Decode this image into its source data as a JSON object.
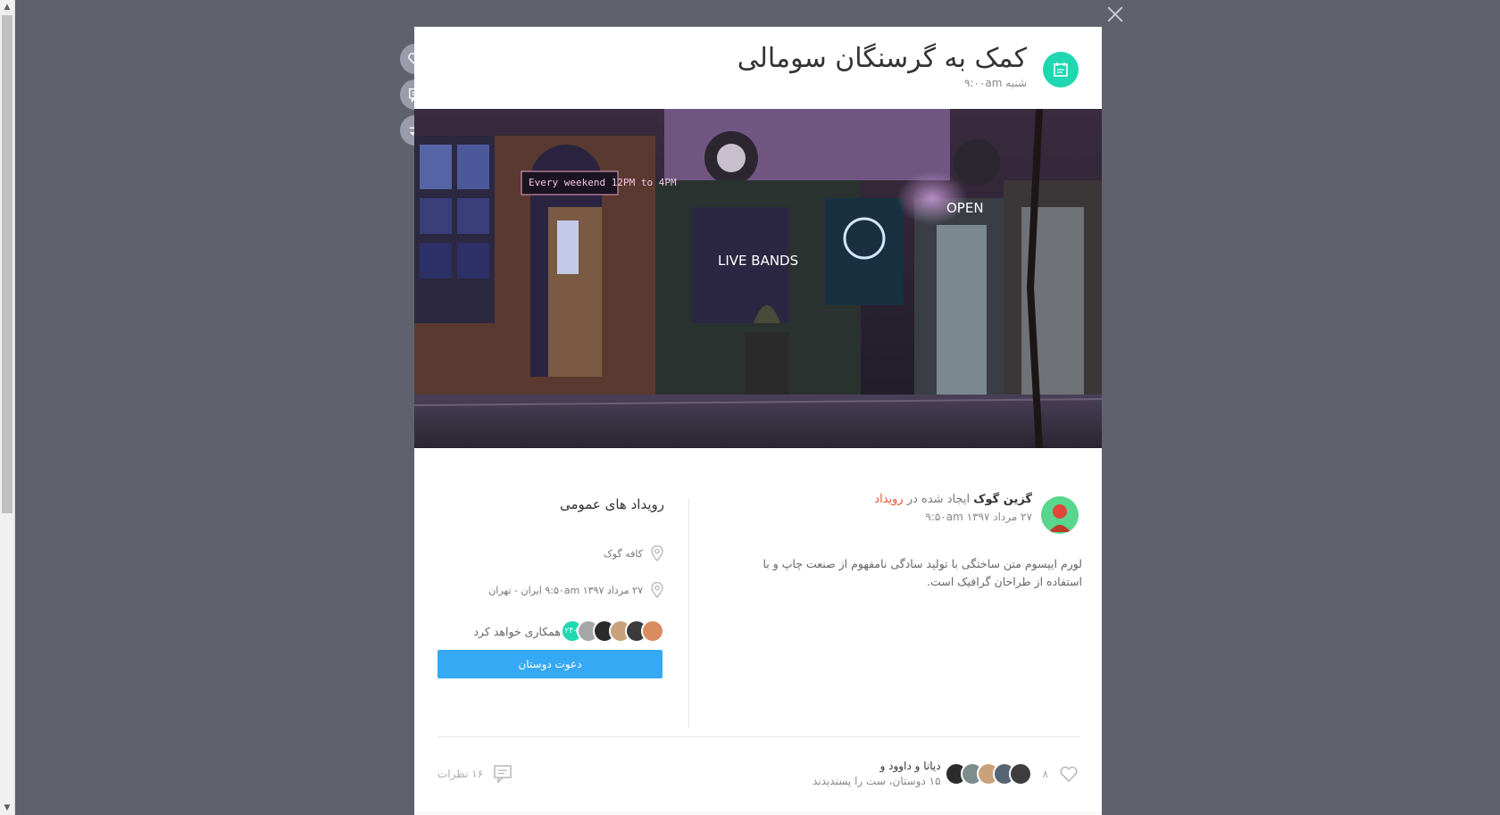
{
  "event": {
    "title": "کمک به گرسنگان سومالی",
    "day_time": "شنبه ۹:۰۰am",
    "hero_sign_text": "Every weekend 12PM to 4PM",
    "hero_live_bands": "LIVE BANDS",
    "hero_open": "OPEN"
  },
  "post": {
    "author": "گزین گوک",
    "created_text": "ایجاد شده در",
    "created_link": "رویداد",
    "date": "۲۷ مرداد ۱۳۹۷ ۹:۵۰am",
    "body": "لورم ایپسوم متن ساختگی با تولید سادگی نامفهوم از صنعت چاپ و با استفاده از طراحان گرافیک است."
  },
  "details": {
    "section_title": "رویداد های عمومی",
    "place": "کافه گوک",
    "when_where": "۲۷ مرداد ۱۳۹۷ ۹:۵۰am ایران - تهران",
    "attendees_badge": "۲۴+",
    "attendees_text": "همکاری خواهد کرد",
    "invite_label": "دعوت دوستان"
  },
  "footer": {
    "like_count": "۸",
    "likers_line1": "دیانا و داوود و",
    "likers_line2": "۱۵ دوستان، ست را پسندیدند",
    "comments": "۱۶ نظرات"
  },
  "colors": {
    "accent_teal": "#1fd8b1",
    "accent_blue": "#36a9f4",
    "link_red": "#e8522f"
  }
}
